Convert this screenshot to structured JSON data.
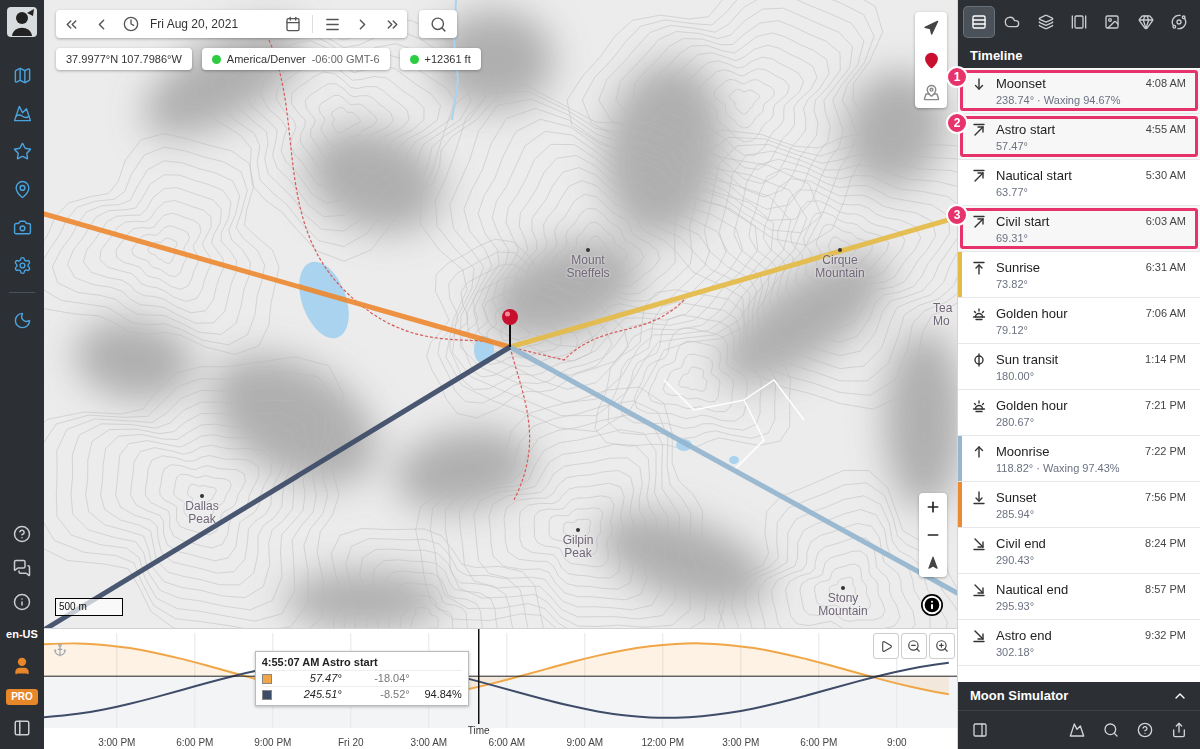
{
  "sidebar": {
    "locale": "en-US",
    "badge": "PRO"
  },
  "toolbar": {
    "date": "Fri Aug 20, 2021"
  },
  "chips": [
    {
      "text": "37.9977°N 107.7986°W",
      "extra": "",
      "dot": false
    },
    {
      "text": "America/Denver",
      "extra": "-06:00 GMT-6",
      "dot": true
    },
    {
      "text": "+12361 ft",
      "extra": "",
      "dot": true
    }
  ],
  "map": {
    "labels": [
      "Mount Sneffels",
      "Cirque Mountain",
      "Dallas Peak",
      "Gilpin Peak",
      "Stony Mountain",
      "Tea Mo"
    ],
    "scale": "500 m",
    "rays": [
      {
        "azimuth": 73.82,
        "color": "#e4bb47"
      },
      {
        "azimuth": 285.94,
        "color": "#ec8a33"
      },
      {
        "azimuth": 118.82,
        "color": "#94b6cf"
      },
      {
        "azimuth": 238.74,
        "color": "#3c4a67"
      }
    ]
  },
  "panel": {
    "tabs": [
      {
        "selected": true
      },
      {
        "selected": false
      },
      {
        "selected": false
      },
      {
        "selected": false
      },
      {
        "selected": false
      },
      {
        "selected": false
      },
      {
        "selected": false
      }
    ],
    "title": "Timeline",
    "footer": {
      "title": "Moon Simulator",
      "expanded": false
    }
  },
  "timeline": [
    {
      "kind": "moonset",
      "label": "Moonset",
      "detail": "238.74° · Waxing 94.67%",
      "time": "4:08 AM",
      "color": null,
      "highlighted": true,
      "marker": "1"
    },
    {
      "kind": "twilight-start",
      "label": "Astro start",
      "detail": "57.47°",
      "time": "4:55 AM",
      "color": null,
      "highlighted": true,
      "marker": "2"
    },
    {
      "kind": "twilight-start",
      "label": "Nautical start",
      "detail": "63.77°",
      "time": "5:30 AM",
      "color": null,
      "highlighted": false,
      "marker": null
    },
    {
      "kind": "twilight-start",
      "label": "Civil start",
      "detail": "69.31°",
      "time": "6:03 AM",
      "color": null,
      "highlighted": true,
      "marker": "3"
    },
    {
      "kind": "sunrise",
      "label": "Sunrise",
      "detail": "73.82°",
      "time": "6:31 AM",
      "color": "#e4bb47",
      "highlighted": false,
      "marker": null
    },
    {
      "kind": "golden-hour",
      "label": "Golden hour",
      "detail": "79.12°",
      "time": "7:06 AM",
      "color": null,
      "highlighted": false,
      "marker": null
    },
    {
      "kind": "transit",
      "label": "Sun transit",
      "detail": "180.00°",
      "time": "1:14 PM",
      "color": null,
      "highlighted": false,
      "marker": null
    },
    {
      "kind": "golden-hour",
      "label": "Golden hour",
      "detail": "280.67°",
      "time": "7:21 PM",
      "color": null,
      "highlighted": false,
      "marker": null
    },
    {
      "kind": "moonrise",
      "label": "Moonrise",
      "detail": "118.82° · Waxing 97.43%",
      "time": "7:22 PM",
      "color": "#94b6cf",
      "highlighted": false,
      "marker": null
    },
    {
      "kind": "sunset",
      "label": "Sunset",
      "detail": "285.94°",
      "time": "7:56 PM",
      "color": "#ec8a33",
      "highlighted": false,
      "marker": null
    },
    {
      "kind": "twilight-end",
      "label": "Civil end",
      "detail": "290.43°",
      "time": "8:24 PM",
      "color": null,
      "highlighted": false,
      "marker": null
    },
    {
      "kind": "twilight-end",
      "label": "Nautical end",
      "detail": "295.93°",
      "time": "8:57 PM",
      "color": null,
      "highlighted": false,
      "marker": null
    },
    {
      "kind": "twilight-end",
      "label": "Astro end",
      "detail": "302.18°",
      "time": "9:32 PM",
      "color": null,
      "highlighted": false,
      "marker": null
    }
  ],
  "chart": {
    "x_ticks": [
      "3:00 PM",
      "6:00 PM",
      "9:00 PM",
      "Fri 20",
      "3:00 AM",
      "6:00 AM",
      "9:00 AM",
      "12:00 PM",
      "3:00 PM",
      "6:00 PM",
      "9:00"
    ],
    "cursor": {
      "label": "Time",
      "hour": 28.92
    },
    "series": [
      {
        "name": "sun",
        "color": "#f0a646",
        "values": [
          52.7,
          55.0,
          54.2,
          50.2,
          43.4,
          34.2,
          23.3,
          11.4,
          -0.7,
          -12.2,
          -22.2,
          -30.2,
          -35.5,
          -37.8,
          -37.0,
          -33.0,
          -26.2,
          -17.0,
          -6.1,
          5.8,
          17.9,
          29.4,
          39.4,
          47.4,
          52.7,
          55.0,
          54.2,
          50.2,
          43.4,
          34.2,
          23.3,
          11.4,
          -0.7,
          -12.2,
          -22.2,
          -30.2
        ]
      },
      {
        "name": "moon",
        "color": "#3f4c68",
        "values": [
          -69.2,
          -65.8,
          -59.6,
          -51.1,
          -40.7,
          -29.0,
          -16.9,
          -5.0,
          5.7,
          14.7,
          21.4,
          25.3,
          26.2,
          24.1,
          19.0,
          11.4,
          1.6,
          -9.7,
          -21.7,
          -33.7,
          -45.0,
          -54.8,
          -62.5,
          -67.5,
          -69.7,
          -68.7,
          -64.8,
          -58.1,
          -49.2,
          -38.4,
          -26.5,
          -14.5,
          -2.7,
          7.7,
          16.2,
          22.4
        ]
      }
    ],
    "tooltip": {
      "title": "4:55:07 AM Astro start",
      "rows": [
        {
          "color": "#f0a646",
          "azimuth": "57.47°",
          "altitude": "-18.04°",
          "extra": ""
        },
        {
          "color": "#3f4c68",
          "azimuth": "245.51°",
          "altitude": "-8.52°",
          "extra": "94.84%"
        }
      ]
    }
  }
}
